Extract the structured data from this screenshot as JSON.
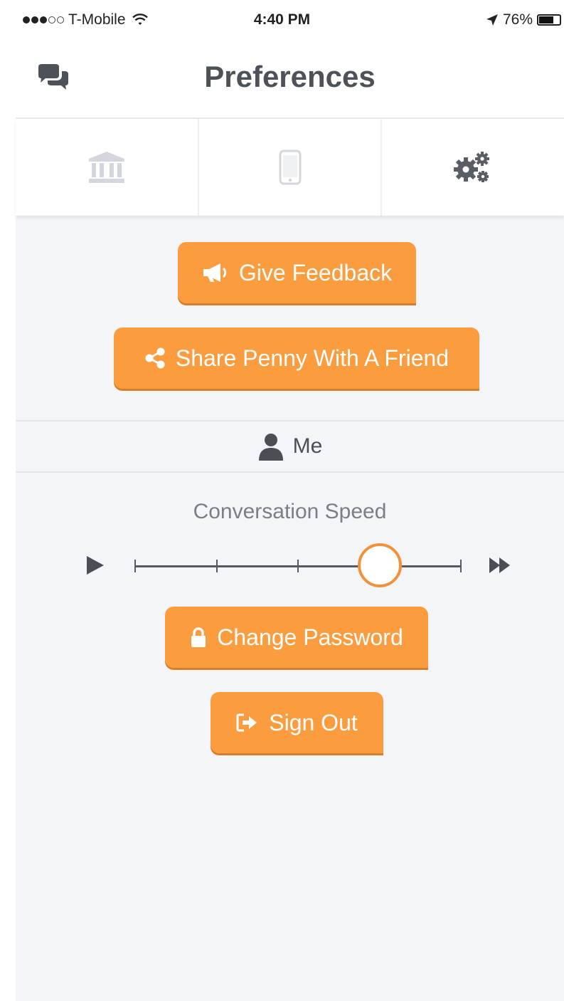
{
  "status_bar": {
    "carrier": "T-Mobile",
    "time": "4:40 PM",
    "battery": "76%",
    "battery_level": 0.76,
    "signal_bars": 3
  },
  "header": {
    "title": "Preferences",
    "left_icon": "chat-bubbles-icon"
  },
  "tabs": [
    {
      "icon": "bank-icon",
      "active": false
    },
    {
      "icon": "phone-icon",
      "active": false
    },
    {
      "icon": "gears-icon",
      "active": true
    }
  ],
  "actions": {
    "feedback_label": "Give Feedback",
    "share_label": "Share Penny With A Friend"
  },
  "me_section": {
    "label": "Me",
    "speed_label": "Conversation Speed",
    "speed_value": 0.75,
    "speed_steps": 5
  },
  "account": {
    "change_password_label": "Change Password",
    "sign_out_label": "Sign Out"
  },
  "colors": {
    "accent": "#fb9c3e",
    "background": "#f4f5f9",
    "title": "#4d5259"
  }
}
